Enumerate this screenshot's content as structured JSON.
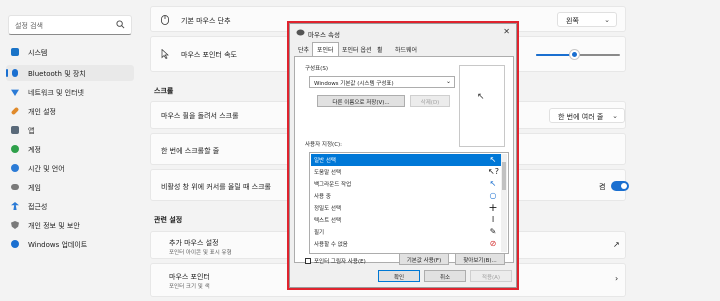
{
  "sidebar": {
    "search_placeholder": "설정 검색",
    "items": [
      {
        "label": "시스템",
        "icon": "monitor-icon",
        "color": "#1a73c7"
      },
      {
        "label": "Bluetooth 및 장치",
        "icon": "bluetooth-icon",
        "color": "#1a6fd0"
      },
      {
        "label": "네트워크 및 인터넷",
        "icon": "wifi-icon",
        "color": "#2b7bd6"
      },
      {
        "label": "개인 설정",
        "icon": "brush-icon",
        "color": "#e08a2b"
      },
      {
        "label": "앱",
        "icon": "apps-icon",
        "color": "#5a6a7a"
      },
      {
        "label": "계정",
        "icon": "account-icon",
        "color": "#2ea04a"
      },
      {
        "label": "시간 및 언어",
        "icon": "globe-clock-icon",
        "color": "#2b7bd6"
      },
      {
        "label": "게임",
        "icon": "gamepad-icon",
        "color": "#7a7a7a"
      },
      {
        "label": "접근성",
        "icon": "accessibility-icon",
        "color": "#2b7bd6"
      },
      {
        "label": "개인 정보 및 보안",
        "icon": "shield-icon",
        "color": "#7a7a7a"
      },
      {
        "label": "Windows 업데이트",
        "icon": "update-icon",
        "color": "#1a6fd0"
      }
    ]
  },
  "main": {
    "primary_button": {
      "label": "기본 마우스 단추",
      "value": "왼쪽"
    },
    "pointer_speed": {
      "label": "마우스 포인터 속도",
      "level": 0.5
    },
    "scroll_section": "스크롤",
    "wheel_scroll": {
      "label": "마우스 휠을 돌려서 스크롤",
      "value": "한 번에 여러 줄"
    },
    "scroll_lines": {
      "label": "한 번에 스크롤할 줄"
    },
    "inactive_scroll": {
      "label": "비활성 창 위에 커서를 올릴 때 스크롤",
      "value": "켬",
      "on": true
    },
    "related_section": "관련 설정",
    "additional": {
      "label": "추가 마우스 설정",
      "sub": "포인터 아이콘 및 표시 유형"
    },
    "pointer": {
      "label": "마우스 포인터",
      "sub": "포인터 크기 및 색"
    }
  },
  "dialog": {
    "title": "마우스 속성",
    "tabs": [
      "단추",
      "포인터",
      "포인터 옵션",
      "휠",
      "하드웨어"
    ],
    "active_tab": 1,
    "scheme_label": "구성표(S)",
    "scheme_value": "Windows 기본값 (시스템 구성표)",
    "save_as": "다른 이름으로 저장(V)...",
    "delete": "삭제(D)",
    "customize_label": "사용자 지정(C):",
    "cursors": [
      {
        "label": "일반 선택",
        "icon": "arrow-cursor-icon",
        "glyph": "↖"
      },
      {
        "label": "도움말 선택",
        "icon": "help-cursor-icon",
        "glyph": "↖?"
      },
      {
        "label": "백그라운드 작업",
        "icon": "working-cursor-icon",
        "glyph": "↖"
      },
      {
        "label": "사용 중",
        "icon": "busy-cursor-icon",
        "glyph": "○"
      },
      {
        "label": "정밀도 선택",
        "icon": "crosshair-cursor-icon",
        "glyph": "+"
      },
      {
        "label": "텍스트 선택",
        "icon": "text-cursor-icon",
        "glyph": "I"
      },
      {
        "label": "필기",
        "icon": "pen-cursor-icon",
        "glyph": "✎"
      },
      {
        "label": "사용할 수 없음",
        "icon": "unavailable-cursor-icon",
        "glyph": "⊘"
      }
    ],
    "shadow_checkbox": "포인터 그림자 사용(E)",
    "use_default": "기본값 사용(F)",
    "browse": "찾아보기(B)...",
    "ok": "확인",
    "cancel": "취소",
    "apply": "적용(A)"
  }
}
